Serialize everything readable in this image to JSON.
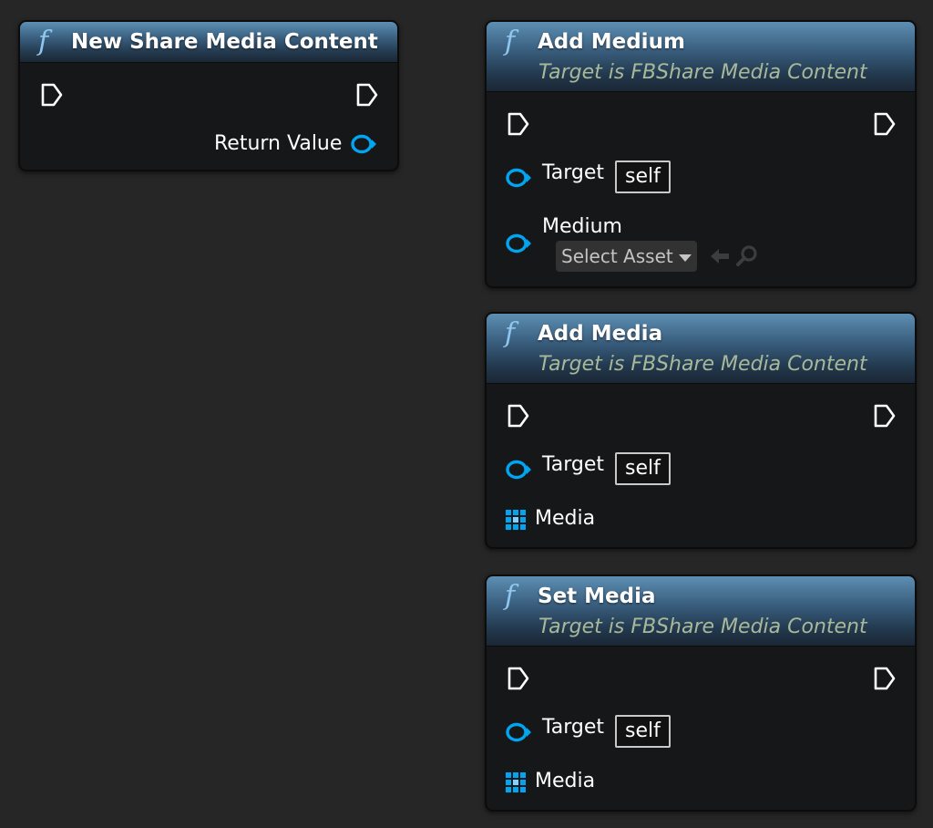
{
  "nodes": {
    "new_share": {
      "title": "New Share Media Content",
      "return_label": "Return Value"
    },
    "add_medium": {
      "title": "Add Medium",
      "subtitle": "Target is FBShare Media Content",
      "target_label": "Target",
      "target_value": "self",
      "medium_label": "Medium",
      "select_asset": "Select Asset"
    },
    "add_media": {
      "title": "Add Media",
      "subtitle": "Target is FBShare Media Content",
      "target_label": "Target",
      "target_value": "self",
      "media_label": "Media"
    },
    "set_media": {
      "title": "Set Media",
      "subtitle": "Target is FBShare Media Content",
      "target_label": "Target",
      "target_value": "self",
      "media_label": "Media"
    }
  },
  "colors": {
    "canvas": "#262626",
    "node_body": "#161718",
    "header_top": "#5d8fb3",
    "object_pin": "#00a6f2",
    "exec_pin": "#ffffff",
    "subtitle": "#a9b89a"
  },
  "icons": {
    "function": "function-icon",
    "exec": "exec-pin-icon",
    "object": "object-pin-icon",
    "array": "array-pin-icon",
    "browse_back": "arrow-left-icon",
    "browse_find": "search-icon"
  }
}
